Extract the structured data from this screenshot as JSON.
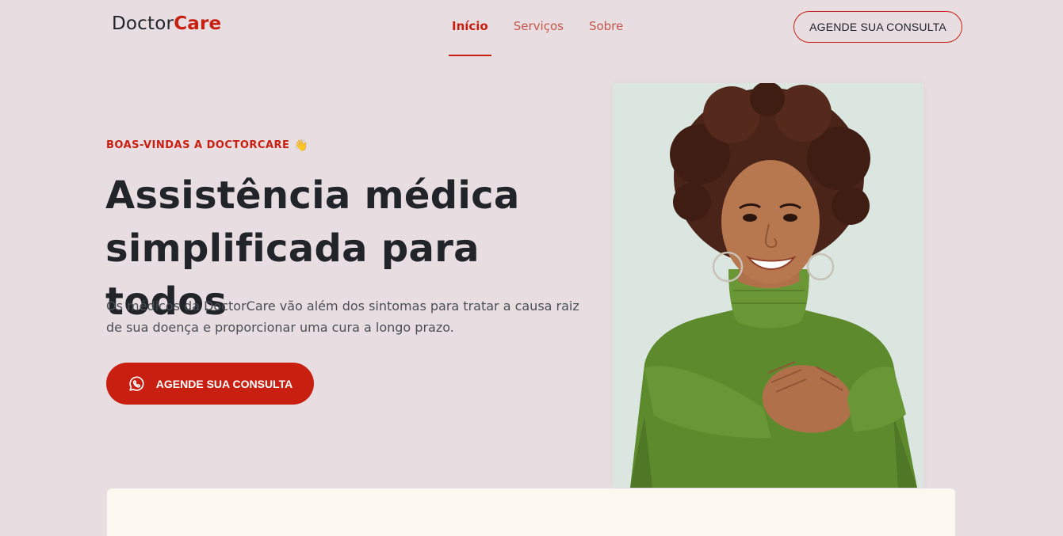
{
  "header": {
    "logo": {
      "text": "Doctor",
      "accent": "Care"
    },
    "nav": [
      {
        "label": "Início",
        "active": true
      },
      {
        "label": "Serviços",
        "active": false
      },
      {
        "label": "Sobre",
        "active": false
      }
    ],
    "cta_label": "AGENDE SUA CONSULTA"
  },
  "hero": {
    "eyebrow": "BOAS-VINDAS A DOCTORCARE",
    "eyebrow_emoji": "👋",
    "title_line1": "Assistência médica",
    "title_line2": "simplificada para todos",
    "description": "Os médicos da DoctorCare vão além dos sintomas para tratar a causa raiz de sua doença e proporcionar uma cura a longo prazo.",
    "cta_label": "AGENDE SUA CONSULTA",
    "cta_icon": "whatsapp-icon"
  },
  "colors": {
    "brand": "#c91f10",
    "background": "#e8dde1",
    "card": "#fef9f0",
    "heading": "#212529"
  }
}
